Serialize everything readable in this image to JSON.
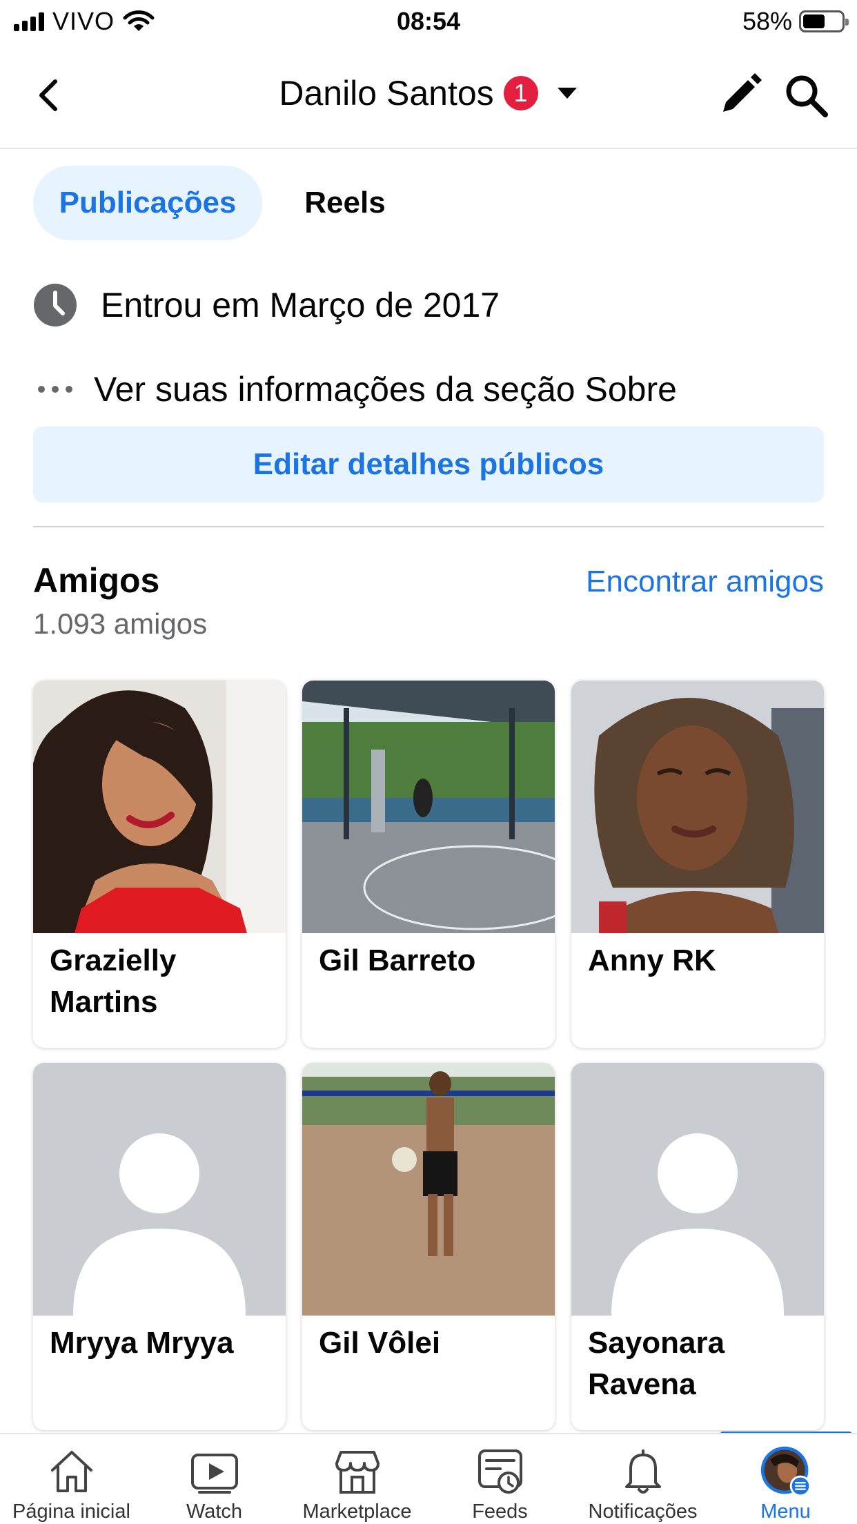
{
  "status_bar": {
    "carrier": "VIVO",
    "time": "08:54",
    "battery": "58%",
    "battery_level": 0.58
  },
  "header": {
    "title": "Danilo Santos",
    "badge_count": "1"
  },
  "tabs": [
    {
      "label": "Publicações",
      "active": true
    },
    {
      "label": "Reels",
      "active": false
    }
  ],
  "info": {
    "joined": "Entrou em Março de 2017",
    "about": "Ver suas informações da seção Sobre",
    "edit_details_label": "Editar detalhes públicos"
  },
  "friends": {
    "title": "Amigos",
    "count": "1.093 amigos",
    "find_link": "Encontrar amigos",
    "cards": [
      {
        "name": "Grazielly Martins"
      },
      {
        "name": "Gil Barreto"
      },
      {
        "name": "Anny RK"
      },
      {
        "name": "Mryya Mryya"
      },
      {
        "name": "Gil Vôlei"
      },
      {
        "name": "Sayonara Ravena"
      }
    ]
  },
  "bottom_nav": [
    {
      "label": "Página inicial",
      "icon": "home-icon"
    },
    {
      "label": "Watch",
      "icon": "watch-icon"
    },
    {
      "label": "Marketplace",
      "icon": "marketplace-icon"
    },
    {
      "label": "Feeds",
      "icon": "feeds-icon"
    },
    {
      "label": "Notificações",
      "icon": "bell-icon"
    },
    {
      "label": "Menu",
      "icon": "menu-avatar-icon",
      "active": true
    }
  ],
  "colors": {
    "accent": "#1b74e4",
    "accent_bg": "#e7f3ff",
    "badge": "#e41e3f",
    "secondary_text": "#65676b"
  }
}
